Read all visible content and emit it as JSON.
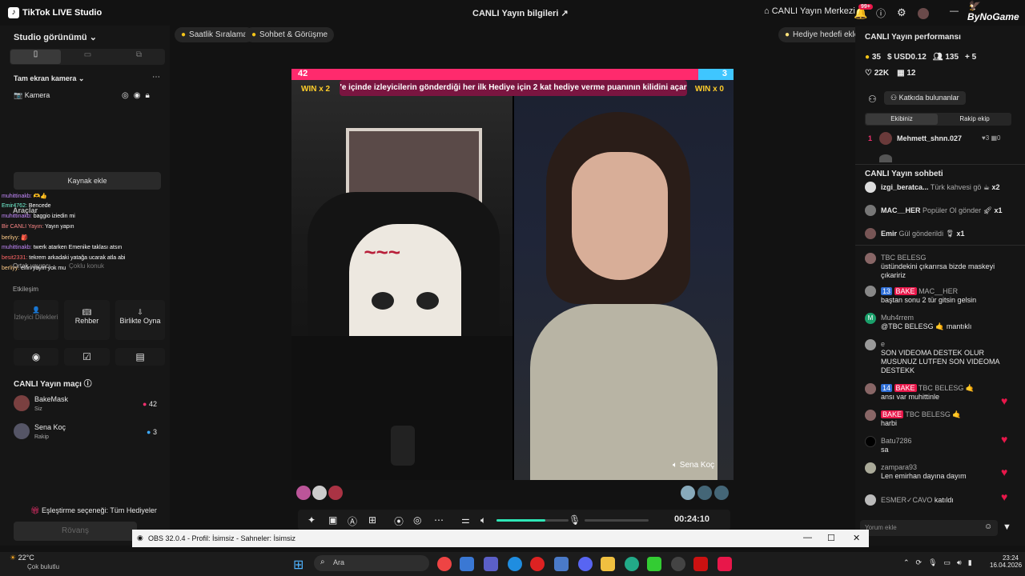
{
  "titlebar": {
    "app": "TikTok LIVE Studio",
    "center": "CANLI Yayın bilgileri",
    "live_center": "CANLI Yayın Merkezi",
    "notif_badge": "99+"
  },
  "watermark": "ByNoGame",
  "left": {
    "studio_view": "Studio görünümü",
    "scene": "Tam ekran kamera",
    "camera": "Kamera",
    "add_source": "Kaynak ekle",
    "tools": "Araçlar",
    "co_host": "Ortak yayıncı",
    "multi_guest": "Çoklu konuk",
    "interaction": "Etkileşim",
    "viewer_requests": "İzleyici Dilekleri",
    "guide": "Rehber",
    "play_together": "Birlikte Oyna",
    "match_title": "CANLI Yayın maçı",
    "player1": {
      "name": "BakeMask",
      "role": "Siz",
      "score": "42"
    },
    "player2": {
      "name": "Sena Koç",
      "role": "Rakip",
      "score": "3"
    },
    "match_option": "Eşleştirme seçeneği: Tüm Hediyeler",
    "rematch": "Rövanş"
  },
  "overlay": [
    {
      "user": "muhittinakb: ",
      "text": "🫶👍"
    },
    {
      "user": "Emir4762: ",
      "text": "Bencede"
    },
    {
      "user": "muhittinakb: ",
      "text": "baggio iziedin mi"
    },
    {
      "user": "Bir CANLI Yayın: ",
      "text": "Yayın yapın"
    },
    {
      "user": "berliyy: ",
      "text": "🎒"
    },
    {
      "user": "muhittinakb: ",
      "text": "twerk atarken Emenike taklası atsın"
    },
    {
      "user": "besit2331: ",
      "text": "tekrem arkadaki yatağa ucarak atla abi"
    },
    {
      "user": "berliyy: ",
      "text": "elfin yayın yok mu"
    }
  ],
  "center": {
    "chip1": "Saatlik Sıralama",
    "chip2": "Sohbet & Görüşme",
    "chip3": "Hediye hedefi ekle",
    "battle": {
      "left_score": "42",
      "right_score": "3",
      "left_win": "WIN x 2",
      "right_win": "WIN x 0",
      "banner": "'e içinde izleyicilerin gönderdiği her ilk Hediye için 2 kat hediye verme puanının kilidini açar"
    },
    "guest_name": "Sena Koç",
    "timer": "00:24:10",
    "volume_level": 0.68
  },
  "right": {
    "perf_title": "CANLI Yayın performansı",
    "stats": {
      "coins": "35",
      "usd": "USD0.12",
      "viewers": "135",
      "follows": "5",
      "likes": "22K",
      "gifts": "12"
    },
    "contributors": "Katkıda bulunanlar",
    "tab_ours": "Ekibiniz",
    "tab_rival": "Rakip ekip",
    "ranking": [
      {
        "rank": "1",
        "user": "Mehmett_shnn.027",
        "likes": "3",
        "gifts": "0"
      }
    ],
    "chat_title": "CANLI Yayın sohbeti",
    "gifts": [
      {
        "user": "izgi_beratca...",
        "text": "Türk kahvesi gö",
        "count": "x2"
      },
      {
        "user": "MAC__HER",
        "text": "Popüler Ol gönder",
        "count": "x1"
      },
      {
        "user": "Emir",
        "text": "Gül gönderildi",
        "count": "x1"
      }
    ],
    "chat": [
      {
        "user": "TBC BELESG",
        "text": "üstündekini çıkarırsa bizde maskeyi çıkaririz"
      },
      {
        "badge": "13",
        "fan": "BAKE",
        "user": "MAC__HER",
        "text": "baştan sonu 2 tür gitsin gelsin"
      },
      {
        "initial": "M",
        "user": "Muh4rrem",
        "text": "@TBC BELESG 🤙 mantıklı"
      },
      {
        "user": "e",
        "text": "SON VIDEOMA DESTEK OLUR MUSUNUZ LUTFEN SON VIDEOMA DESTEKK"
      },
      {
        "badge": "14",
        "fan": "BAKE",
        "user": "TBC BELESG 🤙",
        "text": "ansı var muhittinle"
      },
      {
        "fan": "BAKE",
        "user": "TBC BELESG 🤙",
        "text": "harbi"
      },
      {
        "user": "Batu7286",
        "text": "sa"
      },
      {
        "user": "zampara93",
        "text": "Len emirhan dayına dayım"
      },
      {
        "user": "ESMER✓CAVO",
        "text": "katıldı"
      }
    ],
    "comment_placeholder": "Yorum ekle"
  },
  "obs": {
    "title": "OBS 32.0.4 - Profil: İsimsiz - Sahneler: İsimsiz"
  },
  "taskbar": {
    "temp": "22°C",
    "weather": "Çok bulutlu",
    "search": "Ara",
    "time": "23:24",
    "date": "16.04.2026"
  }
}
